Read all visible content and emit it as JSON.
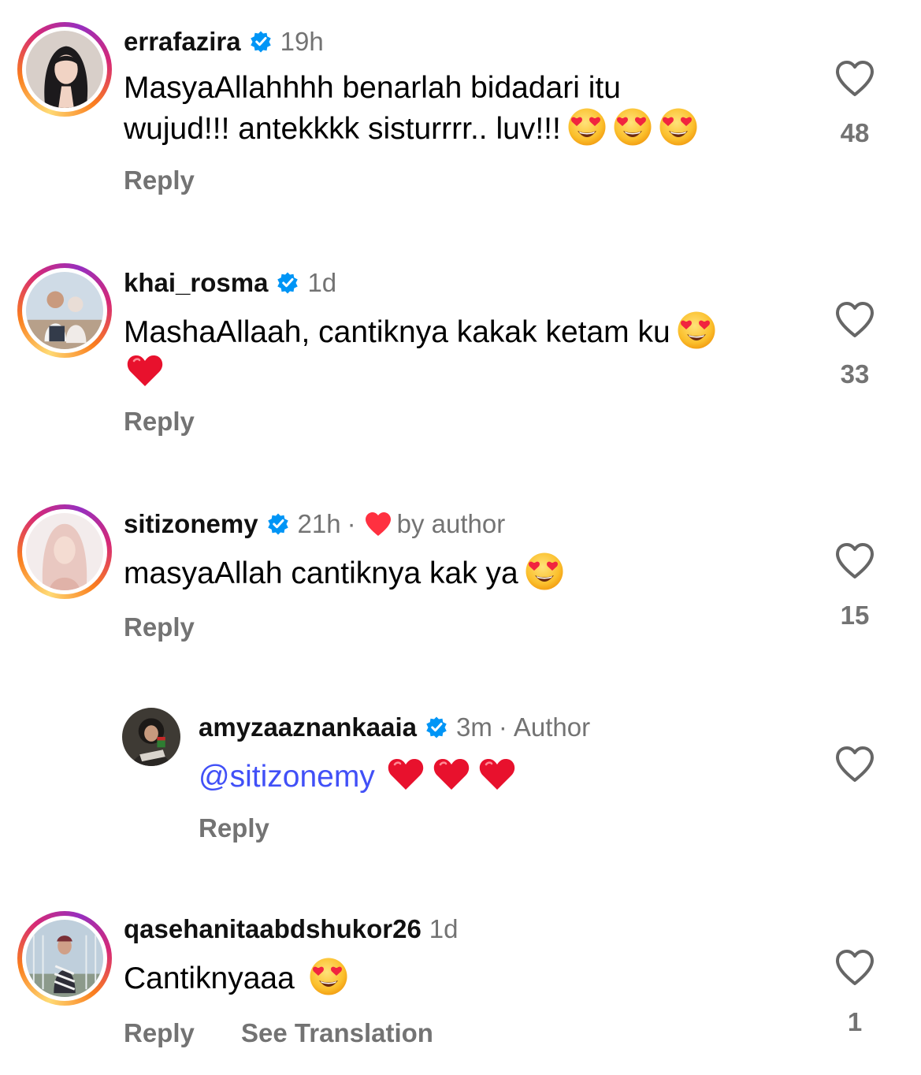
{
  "comments": [
    {
      "username": "errafazira",
      "time": "19h",
      "verified": true,
      "text_line1": "MasyaAllahhhh benarlah bidadari itu",
      "text_line2": "wujud!!! antekkkk sisturrrr.. luv!!!",
      "emojis": [
        "heart-eyes",
        "heart-eyes",
        "heart-eyes"
      ],
      "reply_label": "Reply",
      "likes": "48"
    },
    {
      "username": "khai_rosma",
      "time": "1d",
      "verified": true,
      "text_line1": "MashaAllaah, cantiknya kakak ketam ku",
      "emojis": [
        "heart-eyes",
        "red-heart"
      ],
      "reply_label": "Reply",
      "likes": "33"
    },
    {
      "username": "sitizonemy",
      "time": "21h",
      "verified": true,
      "separator": "·",
      "liked_by_author": "by author",
      "text_line1": "masyaAllah cantiknya kak ya",
      "emojis": [
        "heart-eyes"
      ],
      "reply_label": "Reply",
      "likes": "15"
    },
    {
      "username": "amyzaaznankaaia",
      "time": "3m",
      "verified": true,
      "separator": "·",
      "role": "Author",
      "mention": "@sitizonemy",
      "emojis": [
        "red-heart",
        "red-heart",
        "red-heart"
      ],
      "reply_label": "Reply",
      "likes": ""
    },
    {
      "username": "qasehanitaabdshukor26",
      "time": "1d",
      "verified": false,
      "text_line1": "Cantiknyaaa",
      "emojis": [
        "heart-eyes"
      ],
      "reply_label": "Reply",
      "translation_label": "See Translation",
      "likes": "1"
    }
  ],
  "colors": {
    "secondary_text": "#737373",
    "mention": "#4150f7",
    "verified": "#0095f6",
    "heart": "#ff3040"
  },
  "icons": {
    "like": "heart-outline-icon",
    "verified": "verified-badge-icon",
    "author_like": "red-heart-icon"
  }
}
